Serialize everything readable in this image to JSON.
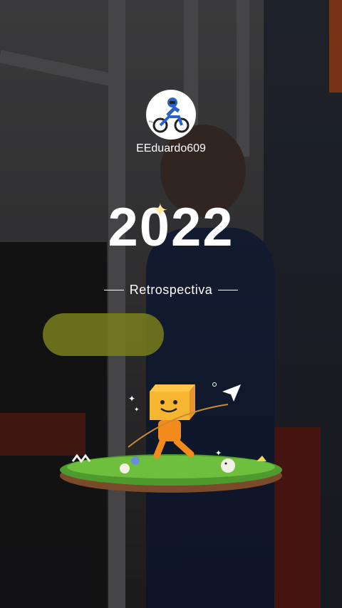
{
  "profile": {
    "username": "EEduardo609",
    "avatar_icon": "motocross-rider-icon"
  },
  "hero": {
    "year": "2022",
    "subtitle": "Retrospectiva"
  },
  "illustration": {
    "icon": "smiling-box-character-on-grass-icon"
  },
  "colors": {
    "text": "#ffffff",
    "grass": "#4f9a2e",
    "character": "#f7a823"
  }
}
